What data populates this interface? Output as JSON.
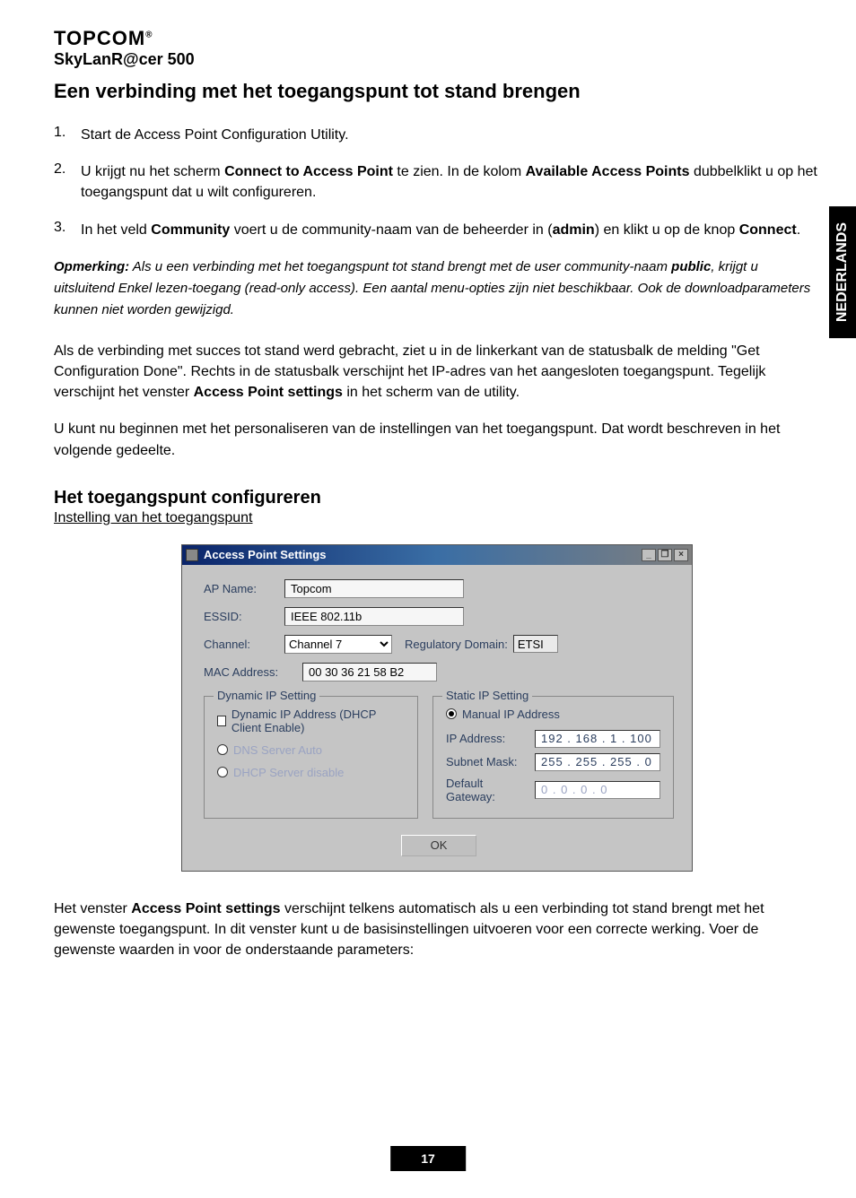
{
  "brand": "TOPCOM",
  "model": "SkyLanR@cer 500",
  "side_tag": "NEDERLANDS",
  "h1": "Een verbinding met het toegangspunt tot stand brengen",
  "steps": {
    "s1_num": "1.",
    "s1": "Start de Access Point Configuration Utility.",
    "s2_num": "2.",
    "s2a": "U krijgt nu het scherm ",
    "s2b": "Connect to Access Point",
    "s2c": " te zien. In de kolom ",
    "s2d": "Available Access Points",
    "s2e": " dubbelklikt u op het toegangspunt dat u wilt configureren.",
    "s3_num": "3.",
    "s3a": "In het veld ",
    "s3b": "Community",
    "s3c": " voert u de community-naam van de beheerder in (",
    "s3d": "admin",
    "s3e": ") en klikt u op de knop ",
    "s3f": "Connect",
    "s3g": "."
  },
  "note": {
    "label": "Opmerking:",
    "t1": " Als u een verbinding met het toegangspunt tot stand brengt met de user community-naam ",
    "pub": "public",
    "t2": ", krijgt u uitsluitend Enkel lezen-toegang (read-only access). Een aantal menu-opties zijn niet beschikbaar. Ook de downloadparameters kunnen niet worden gewijzigd."
  },
  "p2a": "Als de verbinding met succes tot stand werd gebracht, ziet u in de linkerkant van de statusbalk de melding \"Get Configuration Done\". Rechts in de statusbalk verschijnt het IP-adres van het aangesloten toegangspunt. Tegelijk verschijnt het venster ",
  "p2b": "Access Point settings",
  "p2c": " in het scherm van de utility.",
  "p3": "U kunt nu beginnen met het personaliseren van de instellingen van het toegangspunt. Dat wordt beschreven in het volgende gedeelte.",
  "h2": "Het toegangspunt configureren",
  "sub": "Instelling van het toegangspunt",
  "win": {
    "title": "Access Point Settings",
    "min": "_",
    "max": "❐",
    "close": "×",
    "apname_label": "AP Name:",
    "apname": "Topcom",
    "essid_label": "ESSID:",
    "essid": "IEEE 802.11b",
    "channel_label": "Channel:",
    "channel": "Channel 7",
    "regdom_label": "Regulatory Domain:",
    "regdom": "ETSI",
    "mac_label": "MAC Address:",
    "mac": "00 30 36 21 58 B2",
    "dyn_group": "Dynamic IP Setting",
    "dyn_cb": "Dynamic IP Address (DHCP Client Enable)",
    "dns_auto": "DNS Server Auto",
    "dhcp_server": "DHCP Server disable",
    "static_group": "Static IP Setting",
    "manual_radio": "Manual IP Address",
    "ipaddr_label": "IP Address:",
    "ipaddr": "192 . 168 .   1 . 100",
    "subnet_label": "Subnet Mask:",
    "subnet": "255 . 255 . 255 .   0",
    "gateway_label": "Default Gateway:",
    "gateway": "0 .   0 .   0 .   0",
    "ok": "OK"
  },
  "p4a": "Het venster ",
  "p4b": "Access Point settings",
  "p4c": " verschijnt telkens automatisch als u een verbinding tot stand brengt met het gewenste toegangspunt. In dit venster kunt u de basisinstellingen uitvoeren voor een correcte werking. Voer de gewenste waarden in voor de onderstaande parameters:",
  "page_num": "17"
}
